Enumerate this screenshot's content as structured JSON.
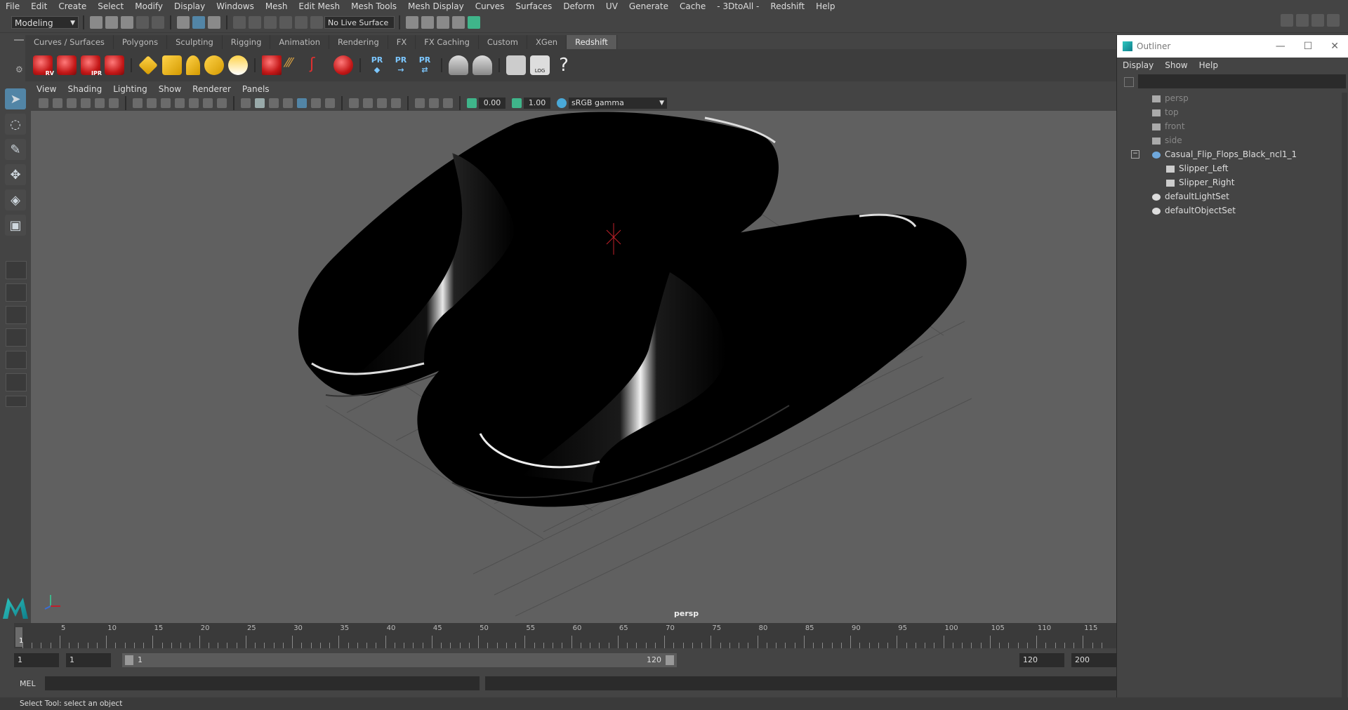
{
  "menubar": [
    "File",
    "Edit",
    "Create",
    "Select",
    "Modify",
    "Display",
    "Windows",
    "Mesh",
    "Edit Mesh",
    "Mesh Tools",
    "Mesh Display",
    "Curves",
    "Surfaces",
    "Deform",
    "UV",
    "Generate",
    "Cache",
    "- 3DtoAll -",
    "Redshift",
    "Help"
  ],
  "status": {
    "mode": "Modeling",
    "live_surface": "No Live Surface"
  },
  "shelf_tabs": [
    "Curves / Surfaces",
    "Polygons",
    "Sculpting",
    "Rigging",
    "Animation",
    "Rendering",
    "FX",
    "FX Caching",
    "Custom",
    "XGen",
    "Redshift"
  ],
  "shelf_icons": {
    "rv": "RV",
    "ipr": "IPR",
    "pr": "PR",
    "log": "LOG",
    "help": "?"
  },
  "viewport": {
    "menu": [
      "View",
      "Shading",
      "Lighting",
      "Show",
      "Renderer",
      "Panels"
    ],
    "exposure": "0.00",
    "gamma_value": "1.00",
    "color_space": "sRGB gamma",
    "camera": "persp"
  },
  "outliner": {
    "title": "Outliner",
    "menu": [
      "Display",
      "Show",
      "Help"
    ],
    "items": [
      {
        "label": "persp",
        "dim": true,
        "type": "camera"
      },
      {
        "label": "top",
        "dim": true,
        "type": "camera"
      },
      {
        "label": "front",
        "dim": true,
        "type": "camera"
      },
      {
        "label": "side",
        "dim": true,
        "type": "camera"
      },
      {
        "label": "Casual_Flip_Flops_Black_ncl1_1",
        "dim": false,
        "type": "group"
      },
      {
        "label": "Slipper_Left",
        "dim": false,
        "type": "mesh"
      },
      {
        "label": "Slipper_Right",
        "dim": false,
        "type": "mesh"
      },
      {
        "label": "defaultLightSet",
        "dim": false,
        "type": "set"
      },
      {
        "label": "defaultObjectSet",
        "dim": false,
        "type": "set"
      }
    ]
  },
  "timeline": {
    "ticks": [
      "5",
      "10",
      "15",
      "20",
      "25",
      "30",
      "35",
      "40",
      "45",
      "50",
      "55",
      "60",
      "65",
      "70",
      "75",
      "80",
      "85",
      "90",
      "95",
      "100",
      "105",
      "110",
      "115"
    ],
    "current": "1",
    "start": "1",
    "playback_start": "1",
    "range_start": "1",
    "range_end": "120",
    "playback_end": "120",
    "end": "200"
  },
  "cmdline": {
    "label": "MEL"
  },
  "help_line": "Select Tool: select an object"
}
